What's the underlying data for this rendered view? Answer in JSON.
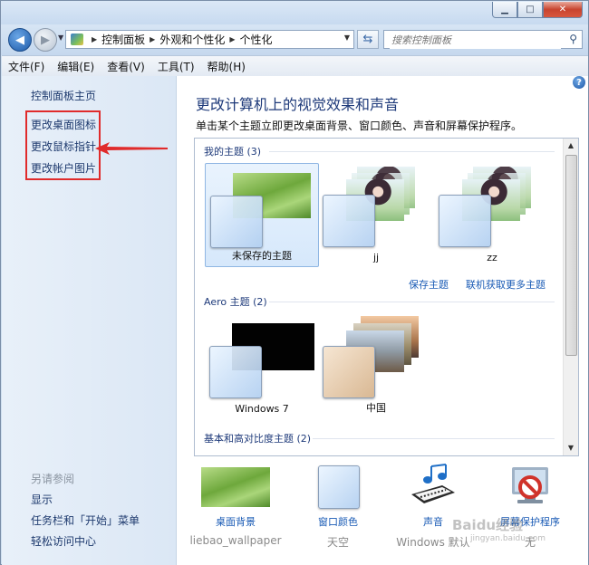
{
  "window": {
    "buttons": {
      "minimize": "▁",
      "maximize": "□",
      "close": "✕"
    }
  },
  "address": {
    "crumbs": [
      "控制面板",
      "外观和个性化",
      "个性化"
    ],
    "search_placeholder": "搜索控制面板"
  },
  "menu": [
    "文件(F)",
    "编辑(E)",
    "查看(V)",
    "工具(T)",
    "帮助(H)"
  ],
  "sidebar": {
    "home": "控制面板主页",
    "tasks": [
      "更改桌面图标",
      "更改鼠标指针",
      "更改帐户图片"
    ],
    "see_also_title": "另请参阅",
    "see_also": [
      "显示",
      "任务栏和「开始」菜单",
      "轻松访问中心"
    ],
    "highlight_color": "#e02b2b"
  },
  "main": {
    "heading": "更改计算机上的视觉效果和声音",
    "subtext": "单击某个主题立即更改桌面背景、窗口颜色、声音和屏幕保护程序。",
    "my_themes": {
      "title": "我的主题 (3)",
      "items": [
        {
          "name": "未保存的主题",
          "selected": true,
          "wallpaper": "grass"
        },
        {
          "name": "jj",
          "selected": false,
          "wallpaper": "portrait"
        },
        {
          "name": "zz",
          "selected": false,
          "wallpaper": "portrait"
        }
      ]
    },
    "save_theme": "保存主题",
    "get_more": "联机获取更多主题",
    "aero_themes": {
      "title": "Aero 主题 (2)",
      "items": [
        {
          "name": "Windows 7",
          "wallpaper": "black"
        },
        {
          "name": "中国",
          "wallpaper": "landscape"
        }
      ]
    },
    "high_contrast": {
      "title": "基本和高对比度主题 (2)"
    }
  },
  "settings": [
    {
      "label": "桌面背景",
      "value": "liebao_wallpaper",
      "icon": "desktop-background-icon"
    },
    {
      "label": "窗口颜色",
      "value": "天空",
      "icon": "window-color-icon"
    },
    {
      "label": "声音",
      "value": "Windows 默认",
      "icon": "sound-icon"
    },
    {
      "label": "屏幕保护程序",
      "value": "无",
      "icon": "screensaver-icon"
    }
  ],
  "watermark": {
    "text": "Baidu经验",
    "url": "jingyan.baidu.com"
  }
}
